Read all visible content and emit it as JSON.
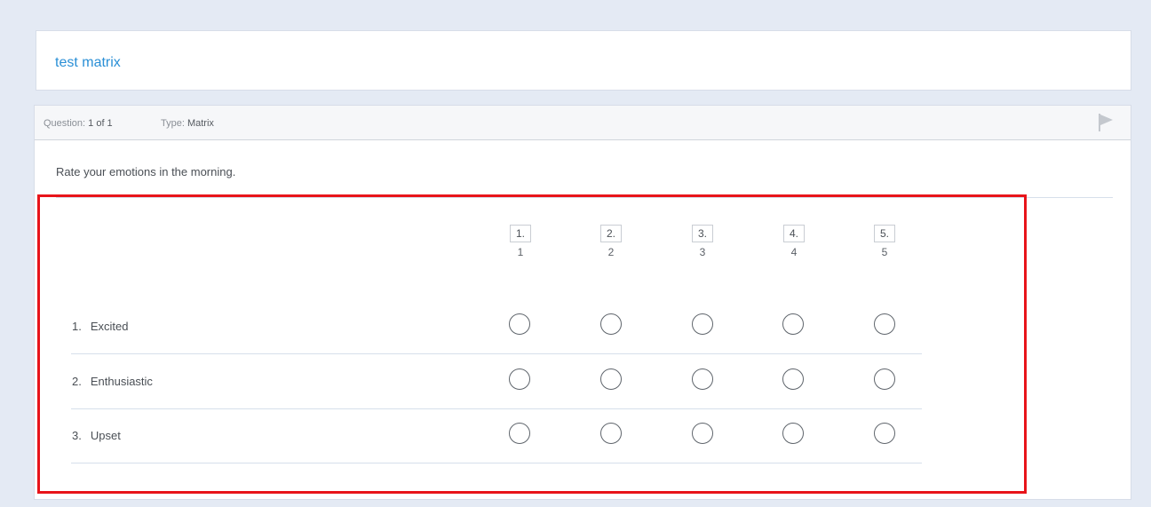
{
  "survey": {
    "title": "test matrix"
  },
  "question": {
    "number_label": "Question:",
    "number_value": "1 of 1",
    "type_label": "Type:",
    "type_value": "Matrix",
    "prompt": "Rate your emotions in the morning.",
    "flag_icon": "flag-icon"
  },
  "matrix": {
    "columns": [
      {
        "index": "1.",
        "label": "1"
      },
      {
        "index": "2.",
        "label": "2"
      },
      {
        "index": "3.",
        "label": "3"
      },
      {
        "index": "4.",
        "label": "4"
      },
      {
        "index": "5.",
        "label": "5"
      }
    ],
    "rows": [
      {
        "num": "1.",
        "label": "Excited"
      },
      {
        "num": "2.",
        "label": "Enthusiastic"
      },
      {
        "num": "3.",
        "label": "Upset"
      }
    ]
  },
  "colors": {
    "accent": "#2a8fd6",
    "highlight": "#e8141a",
    "background": "#e4eaf4"
  }
}
